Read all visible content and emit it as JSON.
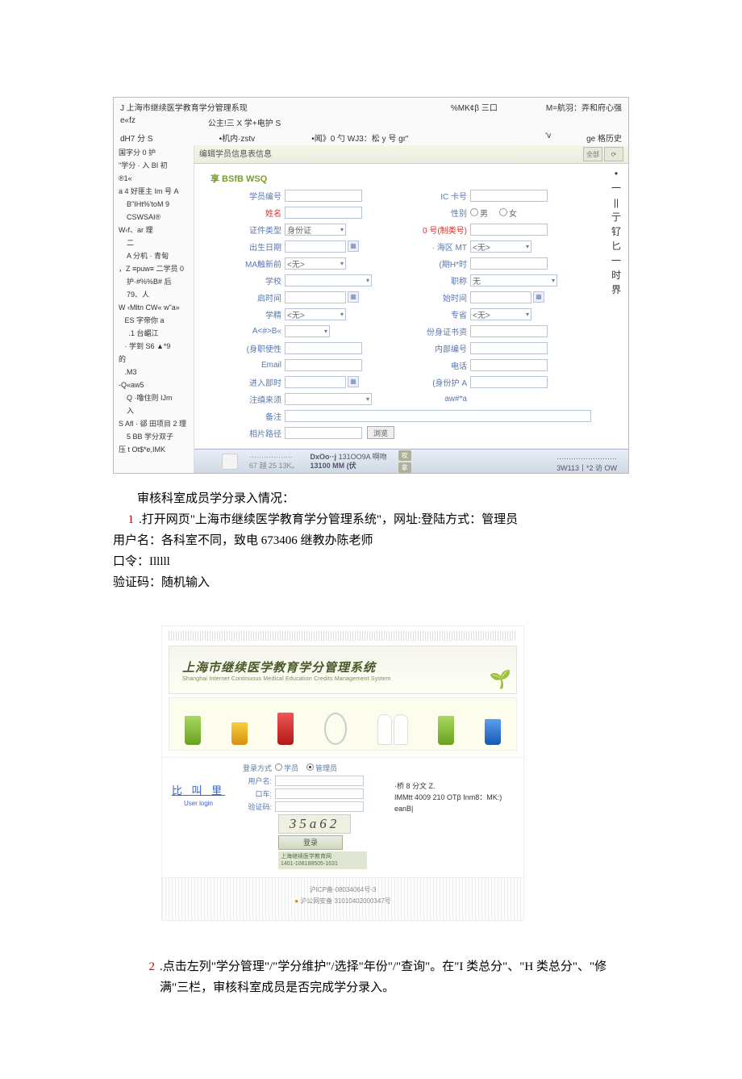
{
  "app": {
    "title": "J 上海市继续医学教育学分管理系现",
    "top_right1": "%MK¢β 三口",
    "top_right2": "M=航羽：弄和府心强",
    "sub1_left": "e«fz",
    "sub1_mid": "公主!三 X 学+电护 S",
    "sub2_left": "dH7 分 S",
    "sub2_mid": "•机内·zstv",
    "sub2_mid2": "•闻》0 勺 WJ3：松 y 号 gr\"",
    "sub2_r1": "'v",
    "sub2_r2": "ge 格历史",
    "side": [
      "国字分 0 护",
      "\"学分 · 入 BI 初",
      "®1«",
      "a 4 好匪主 Im 号 A",
      "    B\"IHt%'toM 9",
      "    CSWSAI®",
      "W‹f、ar 理",
      "    二",
      "    A 分机 · 青甸",
      "，Z ≡puw≡ 二学员 0",
      "    护·#%%B# 后",
      "    79、人",
      "W ‹Mltn CW« w\"a»",
      "",
      "   ES 字帝你 a",
      "",
      "     .1 台嵋江",
      "",
      "   · 学到 S6 ▲*9",
      "的",
      "   .M3",
      "",
      "",
      "-Q«aw5",
      "    Q ·噜住则 IJm",
      "    入",
      "S Afl · 郤 田项目 2 理",
      "    5 BB 学分双子",
      "压 t Ot$*e,IMK"
    ],
    "form_title": "编辑学员信息表信息",
    "btn_top": "全部",
    "section1": "享 BSfB WSQ",
    "labels": {
      "id": "学员编号",
      "ic": "IC 卡号",
      "name": "姓名",
      "gender": "性别",
      "idtype": "证件类型",
      "idno": "0 号(制类号)",
      "birth": "出生日期",
      "district": "· 海区 MT",
      "edu": "MA触新前",
      "degree": "(期H*时",
      "school": "学校",
      "title": "职称",
      "start": "启时间",
      "end": "始时间",
      "ftype": "学精",
      "spec": "专省",
      "a": "A<#>B«",
      "workcert": "份身证书资",
      "emptype": "(身职使性",
      "innerno": "内部编号",
      "email": "Email",
      "phone": "电话",
      "intime": "进入部时",
      "outtype": "(身份护 A",
      "regsrc": "注缜来须",
      "awfa": "aw#*a",
      "remark": "备注",
      "photo": "相片路径"
    },
    "values": {
      "idtype": "身份证",
      "edu": "<无>",
      "ftype": "<无>",
      "district": "<无>",
      "spec": "<无>",
      "title": "无",
      "browse": "浏览"
    },
    "gender": {
      "m": "男",
      "f": "女"
    },
    "right_glyphs": [
      "•",
      "一",
      "||",
      "亍",
      "钌",
      "匕",
      "一",
      "时",
      "界"
    ],
    "footer": {
      "ic1": "DxOo··j",
      "ic2": "131OO9A 啊吻",
      "mm": "13100 MM (伏",
      "s1": "攻",
      "s2": "拿",
      "r1": "3W113丨*2 访 OW"
    }
  },
  "doc": {
    "heading": "审核科室成员学分录入情况：",
    "p1_num": "1",
    "p1_a": ".打开网页\"上海市继续医学教育学分管理系统\"，网址:登陆方式：管理员",
    "p1_b": "用户名：各科室不同，致电 673406 继教办陈老师",
    "p1_c": "口令：Illlll",
    "p1_d": "验证码：随机输入",
    "p2_num": "2",
    "p2_a": ".点击左列\"学分管理\"/\"学分维护\"/选择\"年份\"/\"查询\"。在\"I 类总分\"、\"H 类总分\"、\"修满\"三栏，审核科室成员是否完成学分录入。"
  },
  "login": {
    "banner_cn": "上海市继续医学教育学分管理系统",
    "banner_en": "Shanghai Internet Continuous Medical Education Credits Management System",
    "left1": "比 叫 里",
    "left2": "User login",
    "l_mode": "登录方式",
    "l_mode_a": "学员",
    "l_mode_b": "管理员",
    "l_user": "用户名:",
    "l_pass": "口车:",
    "l_code": "验证码:",
    "captcha": "35a62",
    "btn": "登录",
    "note1": "上海继续医学教育网",
    "note2": "1401-108188505-1631",
    "right1": "·桥 8 分文 Z.",
    "right2": "IMMtt 4009 210 OTβ Inm8：MK:) eanB|",
    "foot1": "沪ICP备·08034064号-3",
    "foot2": "沪公网安备 31010402000347号"
  }
}
